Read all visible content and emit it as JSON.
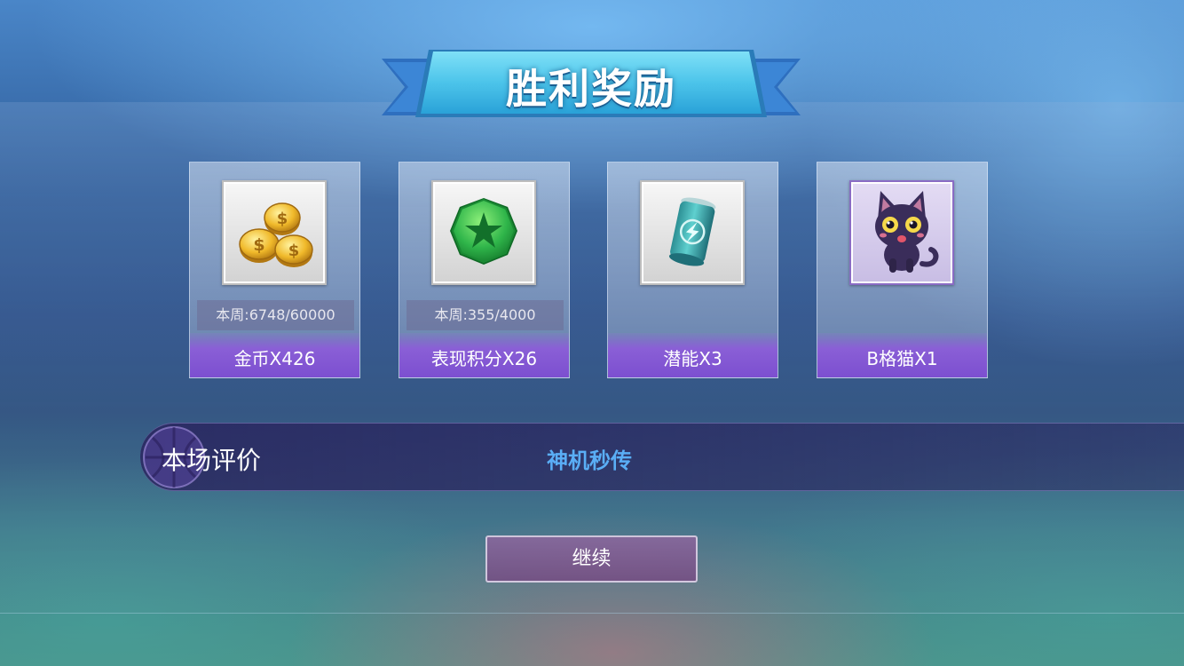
{
  "title": "胜利奖励",
  "rewards": [
    {
      "icon": "gold-coins-icon",
      "progress": "本周:6748/60000",
      "label": "金币X426"
    },
    {
      "icon": "green-star-gem-icon",
      "progress": "本周:355/4000",
      "label": "表现积分X26"
    },
    {
      "icon": "energy-can-icon",
      "progress": "",
      "label": "潜能X3"
    },
    {
      "icon": "black-cat-icon",
      "progress": "",
      "label": "B格猫X1"
    }
  ],
  "rating": {
    "label": "本场评价",
    "value": "神机秒传"
  },
  "continue_label": "继续",
  "colors": {
    "accent_purple": "#8a5fd6",
    "rating_text": "#5aaef6",
    "banner": "#4cc4ea"
  }
}
